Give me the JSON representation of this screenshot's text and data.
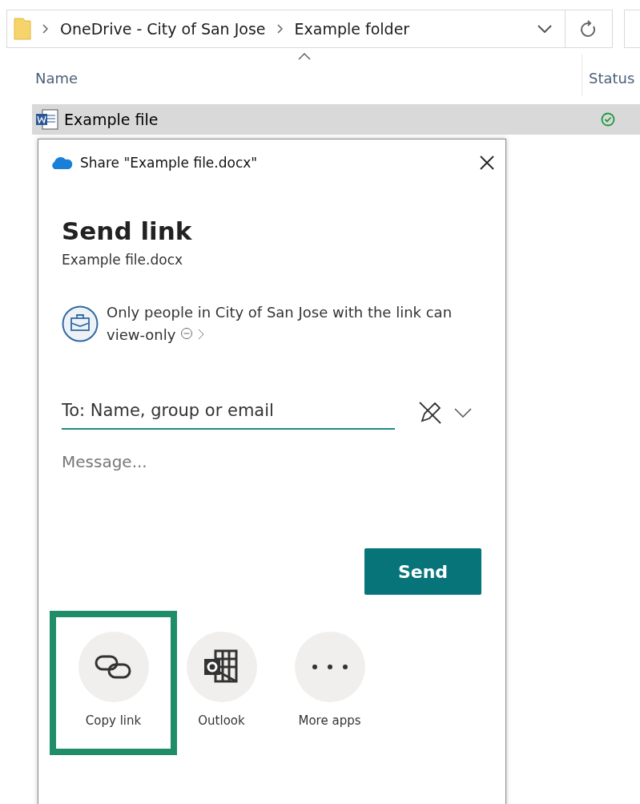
{
  "breadcrumb": [
    "OneDrive - City of San Jose",
    "Example folder"
  ],
  "columns": [
    {
      "label": "Name"
    },
    {
      "label": "Status"
    }
  ],
  "files": [
    {
      "name": "Example file",
      "selected": true,
      "synced": true
    }
  ],
  "dialog": {
    "title": "Share \"Example file.docx\"",
    "heading": "Send link",
    "file_name": "Example file.docx",
    "permission": "Only people in City of San Jose with the link can view-only",
    "to_field": {
      "placeholder": "To: Name, group or email"
    },
    "message_field": {
      "placeholder": "Message..."
    },
    "send_button": "Send",
    "apps": [
      {
        "kind": "link",
        "label": "Copy link",
        "highlighted": true
      },
      {
        "kind": "outlook",
        "label": "Outlook",
        "highlighted": false
      },
      {
        "kind": "more",
        "label": "More apps",
        "highlighted": false
      }
    ]
  }
}
